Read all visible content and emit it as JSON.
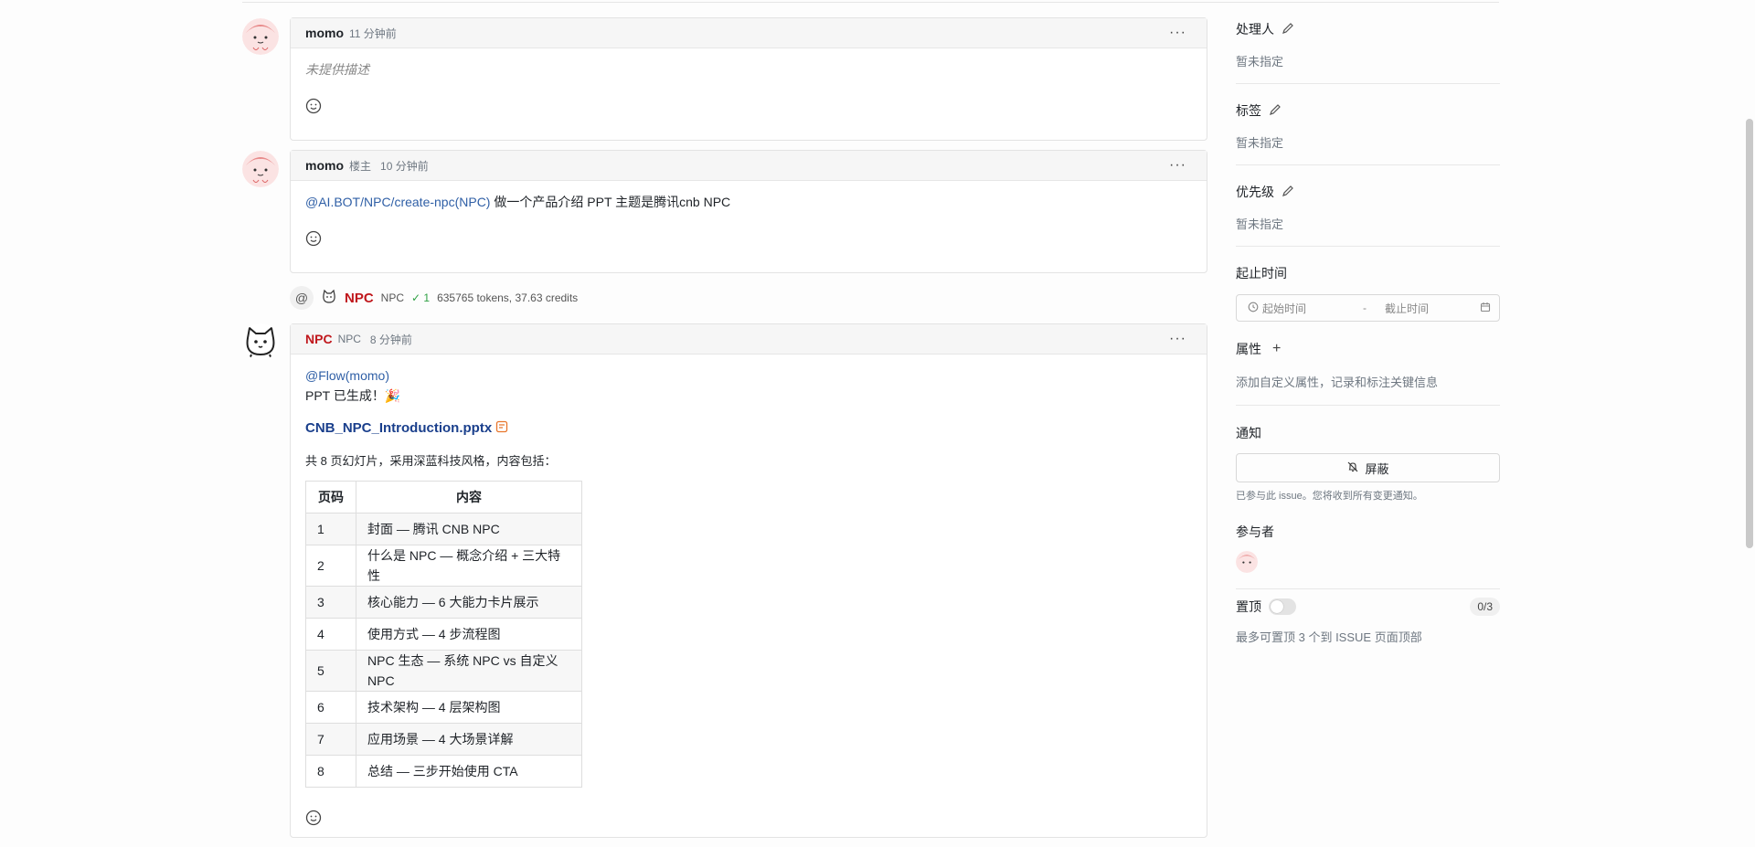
{
  "comments": [
    {
      "author": "momo",
      "meta": "11 分钟前",
      "body": "未提供描述"
    },
    {
      "author": "momo",
      "role": "楼主",
      "meta": "10 分钟前",
      "mention": "@AI.BOT/NPC/create-npc(NPC)",
      "body": " 做一个产品介绍 PPT 主题是腾讯cnb NPC"
    },
    {
      "author": "NPC",
      "role": "NPC",
      "meta": "8 分钟前",
      "mention": "@Flow(momo)",
      "line1": "PPT 已生成！🎉",
      "file": "CNB_NPC_Introduction.pptx",
      "summary": "共 8 页幻灯片，采用深蓝科技风格，内容包括："
    }
  ],
  "npc_bar": {
    "name": "NPC",
    "tag": "NPC",
    "check": "✓ 1",
    "stats": "635765 tokens, 37.63 credits"
  },
  "table": {
    "headers": [
      "页码",
      "内容"
    ],
    "rows": [
      [
        "1",
        "封面 — 腾讯 CNB NPC"
      ],
      [
        "2",
        "什么是 NPC — 概念介绍 + 三大特性"
      ],
      [
        "3",
        "核心能力 — 6 大能力卡片展示"
      ],
      [
        "4",
        "使用方式 — 4 步流程图"
      ],
      [
        "5",
        "NPC 生态 — 系统 NPC vs 自定义 NPC"
      ],
      [
        "6",
        "技术架构 — 4 层架构图"
      ],
      [
        "7",
        "应用场景 — 4 大场景详解"
      ],
      [
        "8",
        "总结 — 三步开始使用 CTA"
      ]
    ]
  },
  "sidebar": {
    "assignee": {
      "title": "处理人",
      "value": "暂未指定"
    },
    "labels": {
      "title": "标签",
      "value": "暂未指定"
    },
    "priority": {
      "title": "优先级",
      "value": "暂未指定"
    },
    "time": {
      "title": "起止时间",
      "start": "起始时间",
      "sep": "-",
      "end": "截止时间"
    },
    "attrs": {
      "title": "属性",
      "value": "添加自定义属性，记录和标注关键信息"
    },
    "notify": {
      "title": "通知",
      "button": "屏蔽",
      "hint": "已参与此 issue。您将收到所有变更通知。"
    },
    "participants": {
      "title": "参与者"
    },
    "pin": {
      "title": "置顶",
      "count": "0/3",
      "hint": "最多可置顶 3 个到 ISSUE 页面顶部"
    }
  },
  "colors": {
    "accent": "#2f5fa6",
    "npc_red": "#c0171c"
  }
}
